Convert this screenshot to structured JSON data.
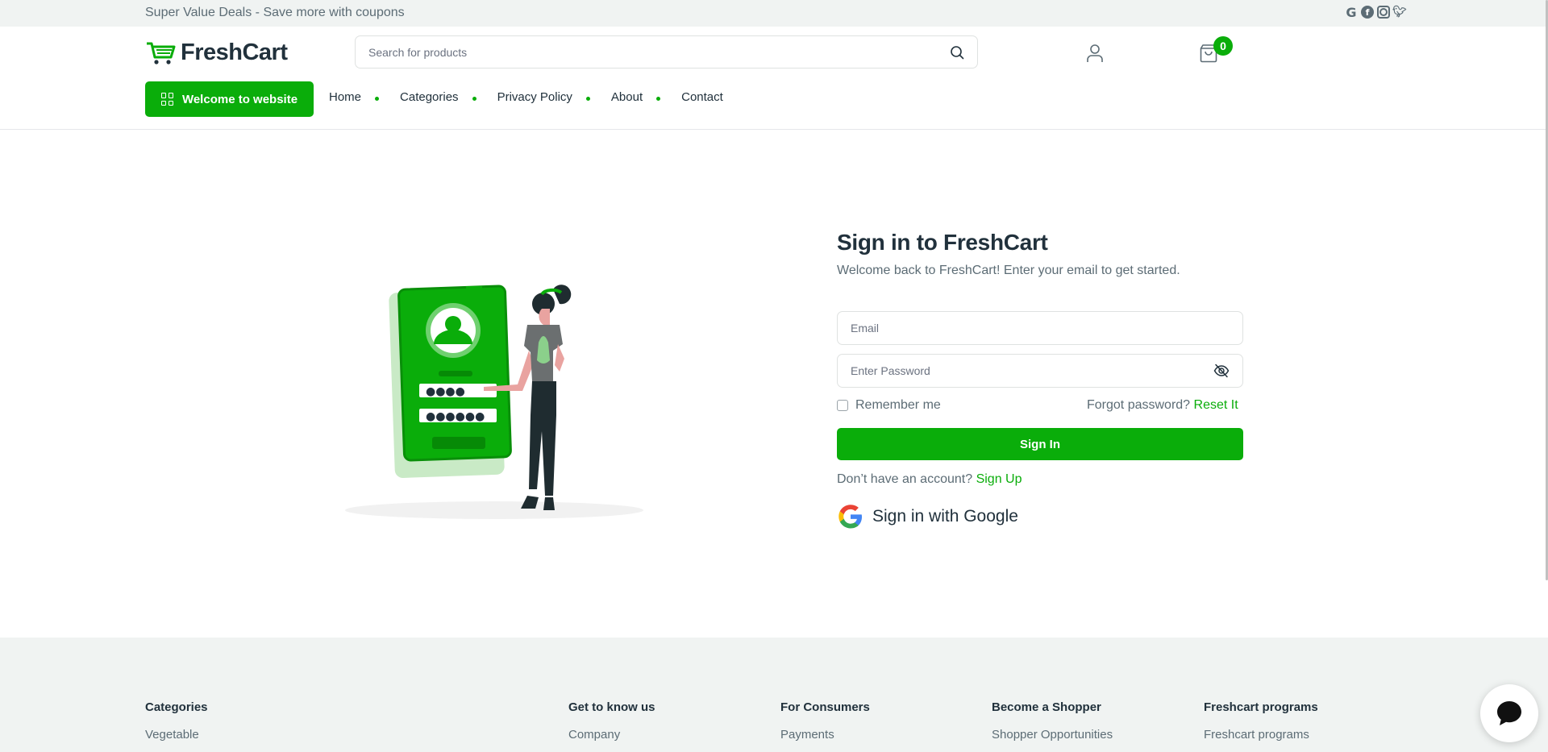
{
  "topbar": {
    "promo": "Super Value Deals - Save more with coupons",
    "socials": [
      "google-icon",
      "facebook-icon",
      "instagram-icon",
      "twitter-icon"
    ]
  },
  "header": {
    "logo": "FreshCart",
    "search_placeholder": "Search for products",
    "cart_count": "0"
  },
  "nav": {
    "welcome_button": "Welcome to website",
    "items": [
      "Home",
      "Categories",
      "Privacy Policy",
      "About",
      "Contact"
    ]
  },
  "signin": {
    "title": "Sign in to FreshCart",
    "subtitle": "Welcome back to FreshCart! Enter your email to get started.",
    "email_placeholder": "Email",
    "password_placeholder": "Enter Password",
    "remember_label": "Remember me",
    "forgot_text": "Forgot password?",
    "reset_link": "Reset It",
    "submit_label": "Sign In",
    "no_account_text": "Don’t have an account?",
    "signup_link": "Sign Up",
    "google_label": "Sign in with Google"
  },
  "footer": {
    "columns": [
      {
        "heading": "Categories",
        "link": "Vegetable"
      },
      {
        "heading": "Get to know us",
        "link": "Company"
      },
      {
        "heading": "For Consumers",
        "link": "Payments"
      },
      {
        "heading": "Become a Shopper",
        "link": "Shopper Opportunities"
      },
      {
        "heading": "Freshcart programs",
        "link": "Freshcart programs"
      }
    ]
  },
  "colors": {
    "brand": "#0aad0a",
    "text_dark": "#21313c",
    "text_muted": "#5c6c75",
    "topbar_bg": "#f0f3f2"
  }
}
